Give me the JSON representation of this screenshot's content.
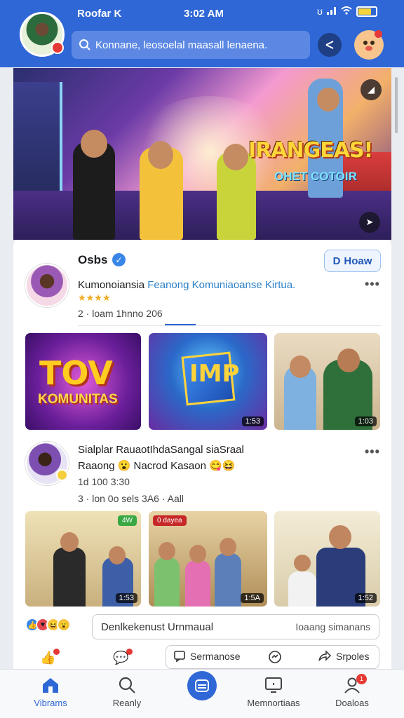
{
  "status": {
    "name": "Roofar K",
    "time": "3:02 AM"
  },
  "search": {
    "placeholder": "Konnane, leosoelal maasall lenaena."
  },
  "hero": {
    "title": "IRANGEAS!",
    "subtitle": "OHET COTOIR"
  },
  "section": {
    "title": "Osbs",
    "follow_label": "Hoaw",
    "follow_icon": "D"
  },
  "post1": {
    "name": "Kumonoiansia",
    "name_accent": "Feanong Komuniaoanse Kirtua.",
    "stars": "★★★★",
    "meta": "2 · loam 1hnno  206"
  },
  "thumbs1": [
    {
      "big": "TOV",
      "small": "KOMUNITAS"
    },
    {
      "cube": "IMP",
      "duration": "1:53"
    },
    {
      "duration": "1:03"
    }
  ],
  "post2": {
    "name": "Sialplar RauaotIhdaSangal siaSraal",
    "subtitle": "Raaong 😮 Nacrod Kasaon 😋😆",
    "meta": "1d 100  3:30",
    "meta2": "3 · lon 0o sels  3A6 · Aall"
  },
  "thumbs2": [
    {
      "tag": "4W",
      "duration": "1:53"
    },
    {
      "tag": "0 dayea",
      "duration": "1:5A"
    },
    {
      "duration": "1:52"
    }
  ],
  "comment": {
    "placeholder": "Denlkekenust Urnmaual",
    "hint": "Ioaang simanans"
  },
  "actions": {
    "comment_label": "Sermanose",
    "share_label": "Srpoles"
  },
  "nav": [
    {
      "label": "Vibrams",
      "icon": "home-icon"
    },
    {
      "label": "Reanly",
      "icon": "search-icon"
    },
    {
      "label": "",
      "icon": "center-icon"
    },
    {
      "label": "Memnortiaas",
      "icon": "tv-icon"
    },
    {
      "label": "Doaloas",
      "icon": "profile-icon",
      "badge": "1"
    }
  ],
  "colors": {
    "brand": "#2f67d6",
    "badge": "#e53935"
  }
}
